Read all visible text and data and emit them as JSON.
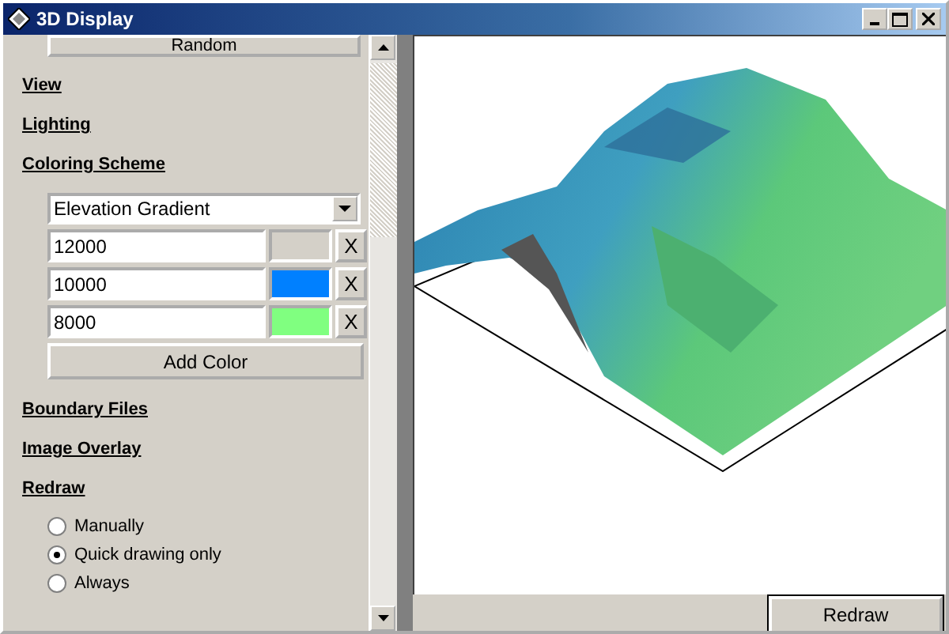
{
  "window": {
    "title": "3D Display"
  },
  "top_button": {
    "label": "Random"
  },
  "sections": [
    {
      "label": "View"
    },
    {
      "label": "Lighting"
    },
    {
      "label": "Coloring Scheme"
    }
  ],
  "coloring": {
    "scheme": "Elevation Gradient",
    "stops": [
      {
        "value": "12000",
        "color": "#d4d0c8",
        "remove": "X"
      },
      {
        "value": "10000",
        "color": "#0080ff",
        "remove": "X"
      },
      {
        "value": "8000",
        "color": "#80ff80",
        "remove": "X"
      }
    ],
    "add_button": "Add Color"
  },
  "sections_after": [
    {
      "label": "Boundary Files"
    },
    {
      "label": "Image Overlay"
    },
    {
      "label": "Redraw"
    }
  ],
  "redraw_options": [
    {
      "label": "Manually",
      "selected": false
    },
    {
      "label": "Quick drawing only",
      "selected": true
    },
    {
      "label": "Always",
      "selected": false
    }
  ],
  "redraw_button": {
    "label": "Redraw"
  }
}
